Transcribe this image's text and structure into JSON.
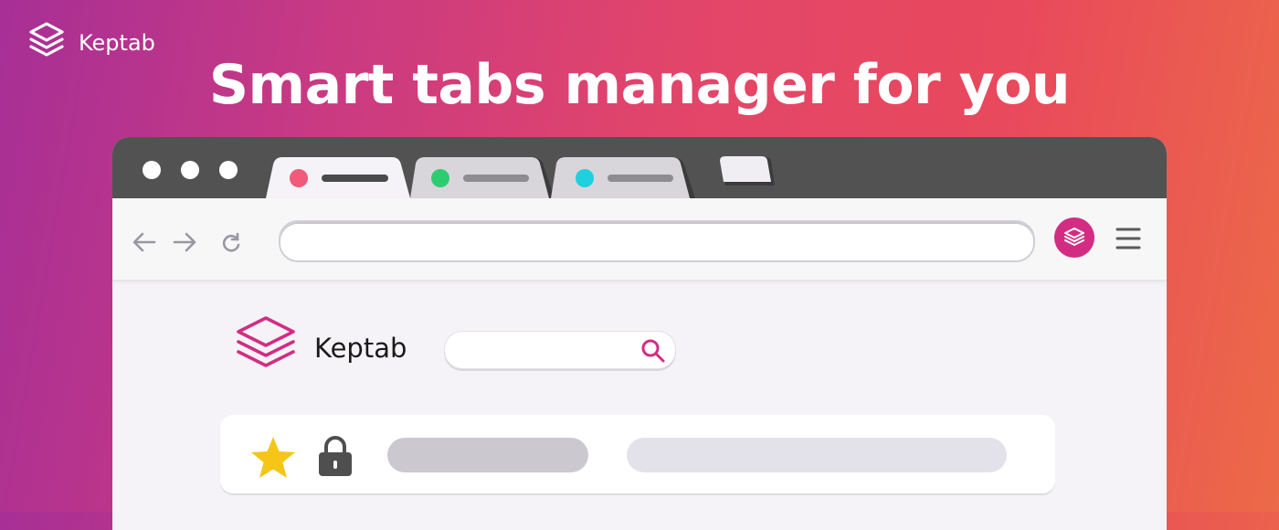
{
  "brand": {
    "name": "Keptab",
    "icon": "layers-stack-icon"
  },
  "headline": "Smart tabs manager for you",
  "colors": {
    "gradient_left": "#a72f96",
    "gradient_right": "#ec6a47",
    "accent": "#d22d83",
    "titlebar": "#525252"
  },
  "browser": {
    "window_controls": [
      "dot",
      "dot",
      "dot"
    ],
    "tabs": [
      {
        "state": "active",
        "dot_color": "#f25a7a"
      },
      {
        "state": "inactive",
        "dot_color": "#2ecc71"
      },
      {
        "state": "inactive",
        "dot_color": "#1fd0de"
      },
      {
        "state": "new-tab"
      }
    ],
    "toolbar": {
      "icons": [
        "back-arrow-icon",
        "forward-arrow-icon",
        "reload-icon",
        "keptab-extension-icon",
        "hamburger-menu-icon"
      ],
      "url_value": ""
    }
  },
  "app": {
    "title": "Keptab",
    "search": {
      "placeholder": "",
      "icon": "search-icon"
    },
    "rows": [
      {
        "icons": [
          "star-icon",
          "lock-icon"
        ]
      }
    ]
  }
}
